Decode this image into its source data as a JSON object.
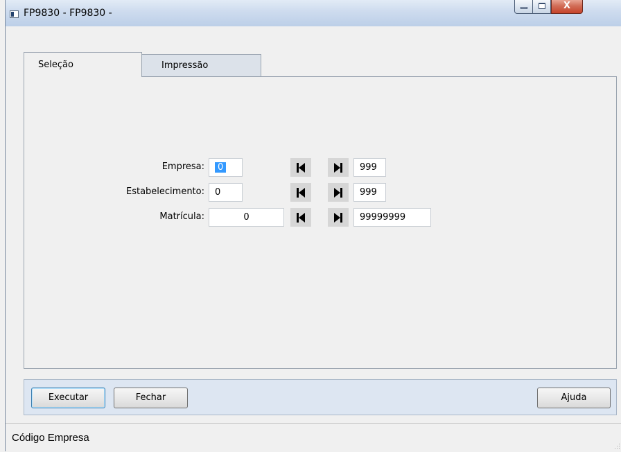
{
  "window": {
    "title": "FP9830 - FP9830 -",
    "caption": {
      "close_glyph": "X"
    }
  },
  "tabs": [
    {
      "label": "Seleção",
      "active": true
    },
    {
      "label": "Impressão",
      "active": false
    }
  ],
  "form": {
    "rows": [
      {
        "label": "Empresa:",
        "from": "0",
        "to": "999"
      },
      {
        "label": "Estabelecimento:",
        "from": "0",
        "to": "999"
      },
      {
        "label": "Matrícula:",
        "from": "0",
        "to": "99999999"
      }
    ]
  },
  "buttons": {
    "execute": "Executar",
    "close": "Fechar",
    "help": "Ajuda"
  },
  "status": {
    "text": "Código Empresa"
  },
  "colors": {
    "selection": "#3399ff",
    "button_bar": "#dde6f2",
    "title_bar": "#cddbee",
    "close_button": "#c7432a"
  }
}
